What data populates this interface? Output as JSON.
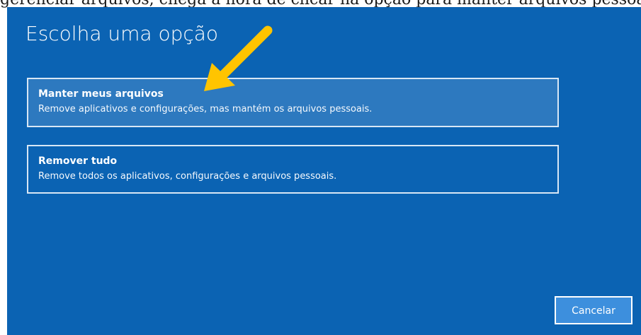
{
  "article_fragment": "gerenciar arquivos, chega a hora de clicar na opção para manter arquivos pessoais...",
  "dialog": {
    "title": "Escolha uma opção",
    "background_color": "#0b63b3"
  },
  "options": [
    {
      "title": "Manter meus arquivos",
      "description": "Remove aplicativos e configurações, mas mantém os arquivos pessoais.",
      "selected": true
    },
    {
      "title": "Remover tudo",
      "description": "Remove todos os aplicativos, configurações e arquivos pessoais.",
      "selected": false
    }
  ],
  "buttons": {
    "cancel": "Cancelar"
  },
  "annotation": {
    "icon": "arrow-pointer-icon",
    "color": "#ffc400"
  }
}
